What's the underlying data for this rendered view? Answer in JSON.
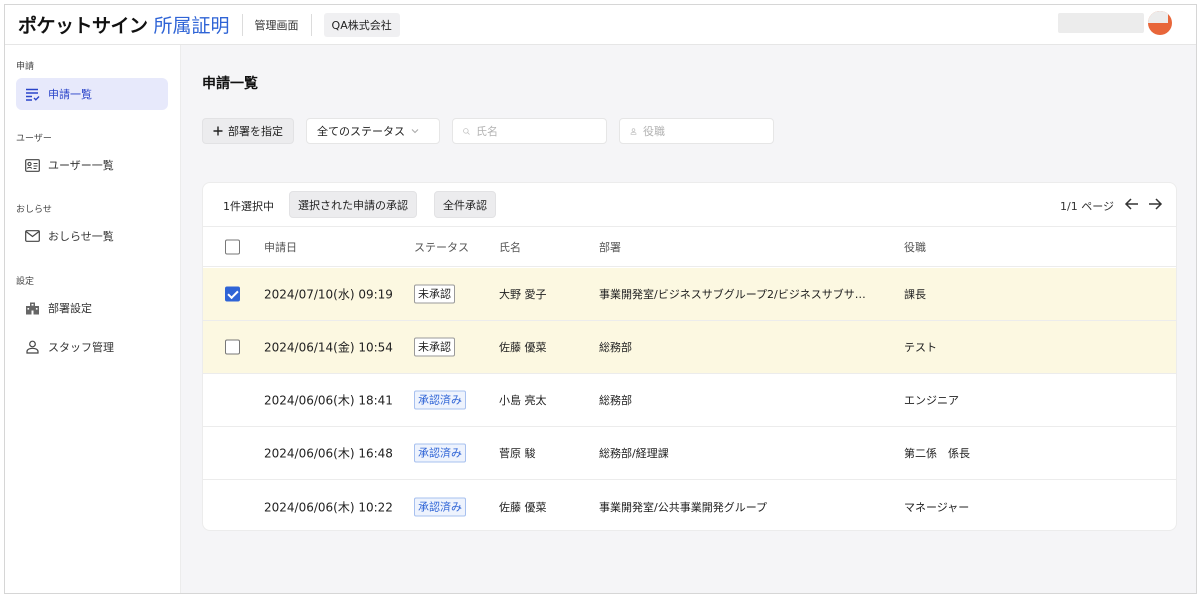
{
  "header": {
    "brand": "ポケットサイン",
    "product": "所属証明",
    "admin_link": "管理画面",
    "company": "QA株式会社"
  },
  "sidebar": {
    "sections": [
      {
        "label": "申請",
        "items": [
          {
            "label": "申請一覧",
            "icon": "list-check-icon",
            "active": true
          }
        ]
      },
      {
        "label": "ユーザー",
        "items": [
          {
            "label": "ユーザー一覧",
            "icon": "id-card-icon",
            "active": false
          }
        ]
      },
      {
        "label": "おしらせ",
        "items": [
          {
            "label": "おしらせ一覧",
            "icon": "mail-icon",
            "active": false
          }
        ]
      },
      {
        "label": "設定",
        "items": [
          {
            "label": "部署設定",
            "icon": "building-icon",
            "active": false
          },
          {
            "label": "スタッフ管理",
            "icon": "user-icon",
            "active": false
          }
        ]
      }
    ]
  },
  "main": {
    "title": "申請一覧",
    "filters": {
      "dept_button": "部署を指定",
      "status_select": "全てのステータス",
      "name_placeholder": "氏名",
      "position_placeholder": "役職"
    },
    "toolbar": {
      "selected_count": "1件選択中",
      "approve_selected": "選択された申請の承認",
      "approve_all": "全件承認",
      "pager": "1/1 ページ"
    },
    "table": {
      "columns": [
        "申請日",
        "ステータス",
        "氏名",
        "部署",
        "役職"
      ],
      "rows": [
        {
          "date": "2024/07/10(水) 09:19",
          "status": "未承認",
          "name": "大野 愛子",
          "dept": "事業開発室/ビジネスサブグループ2/ビジネスサブサ…",
          "position": "課長",
          "checked": true
        },
        {
          "date": "2024/06/14(金) 10:54",
          "status": "未承認",
          "name": "佐藤 優菜",
          "dept": "総務部",
          "position": "テスト",
          "checked": false
        },
        {
          "date": "2024/06/06(木) 18:41",
          "status": "承認済み",
          "name": "小島 亮太",
          "dept": "総務部",
          "position": "エンジニア"
        },
        {
          "date": "2024/06/06(木) 16:48",
          "status": "承認済み",
          "name": "菅原 駿",
          "dept": "総務部/経理課",
          "position": "第二係　係長"
        },
        {
          "date": "2024/06/06(木) 10:22",
          "status": "承認済み",
          "name": "佐藤 優菜",
          "dept": "事業開発室/公共事業開発グループ",
          "position": "マネージャー"
        }
      ]
    }
  },
  "colors": {
    "brand_blue": "#2f64d6",
    "pending_row_bg": "#fcf8e1",
    "active_nav_bg": "#e7e9fb",
    "avatar": "#e8663a"
  }
}
